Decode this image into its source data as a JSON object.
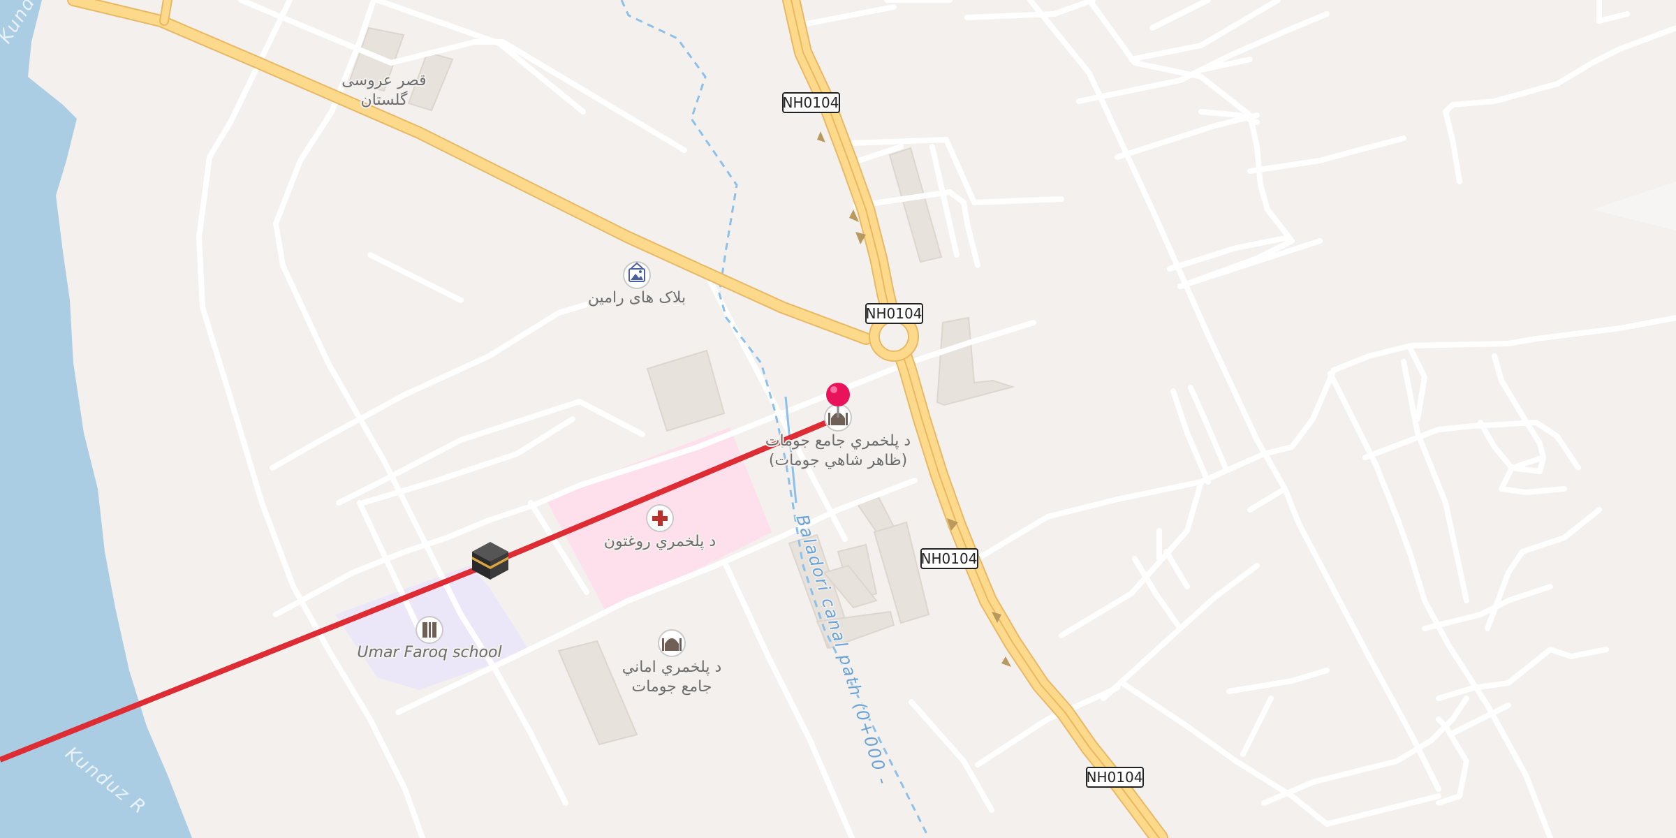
{
  "map": {
    "colors": {
      "land": "#f3f0ed",
      "water": "#abcde3",
      "minor_road": "#ffffff",
      "primary_road": "#fdd98b",
      "primary_road_casing": "#e9b863",
      "hospital_area": "#fde0ec",
      "school_area": "#ece7f8",
      "building": "#e8e2dc",
      "route_line": "#dd2c33",
      "marker_pin": "#e8135a",
      "canal": "#8cc0ea"
    },
    "road_shields": [
      {
        "id": "nh1",
        "text": "NH0104"
      },
      {
        "id": "nh2",
        "text": "NH0104"
      },
      {
        "id": "nh3",
        "text": "NH0104"
      },
      {
        "id": "nh4",
        "text": "NH0104"
      }
    ],
    "pois": {
      "wedding_hall": {
        "line1": "قصر عروسی",
        "line2": "گلستان"
      },
      "gallery": {
        "line1": "بلاک های رامین",
        "icon": "gallery-icon"
      },
      "mosque_main": {
        "line1": "د پلخمري جامع جومات",
        "line2": "(ظاهر شاهي جومات)",
        "icon": "mosque-icon"
      },
      "hospital": {
        "line1": "د پلخمري روغتون",
        "icon": "hospital-cross-icon"
      },
      "school": {
        "line1": "Umar Faroq school",
        "icon": "school-icon"
      },
      "mosque_imani": {
        "line1": "د پلخمري اماني",
        "line2": "جامع جومات",
        "icon": "mosque-icon"
      }
    },
    "water_labels": {
      "river_top": "Kunduz",
      "river_bottom": "Kunduz R"
    },
    "canal_label": "Baladori canal path (0+000 -",
    "markers": {
      "destination": "destination-pin-icon",
      "qibla": "kaaba-icon"
    }
  }
}
